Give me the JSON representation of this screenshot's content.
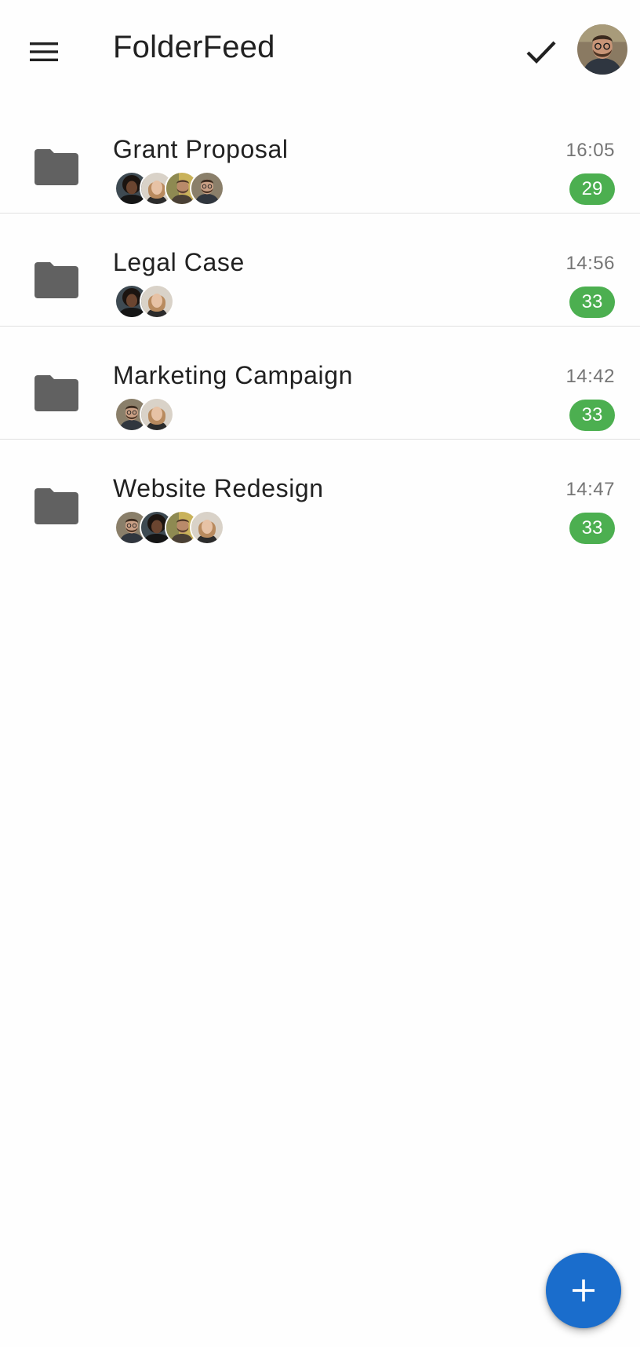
{
  "app": {
    "title": "FolderFeed"
  },
  "header": {
    "menu_icon": "hamburger-menu-icon",
    "action_icon": "checkmark-icon",
    "profile_avatar": "user-profile-photo"
  },
  "colors": {
    "badge_green": "#4caf50",
    "fab_blue": "#1a6dcc",
    "folder_gray": "#616161",
    "text_primary": "#212121",
    "text_secondary": "#757575"
  },
  "folders": [
    {
      "name": "Grant Proposal",
      "time": "16:05",
      "count": "29",
      "members": [
        "curly-hair-person",
        "woman-light-hair",
        "man-beard-outdoor",
        "man-glasses-beard"
      ]
    },
    {
      "name": "Legal Case",
      "time": "14:56",
      "count": "33",
      "members": [
        "curly-hair-person",
        "woman-light-hair"
      ]
    },
    {
      "name": "Marketing Campaign",
      "time": "14:42",
      "count": "33",
      "members": [
        "man-glasses-beard",
        "woman-light-hair"
      ]
    },
    {
      "name": "Website Redesign",
      "time": "14:47",
      "count": "33",
      "members": [
        "man-glasses-beard",
        "curly-hair-person",
        "man-beard-outdoor",
        "woman-light-hair"
      ]
    }
  ],
  "fab": {
    "icon": "plus-icon"
  }
}
